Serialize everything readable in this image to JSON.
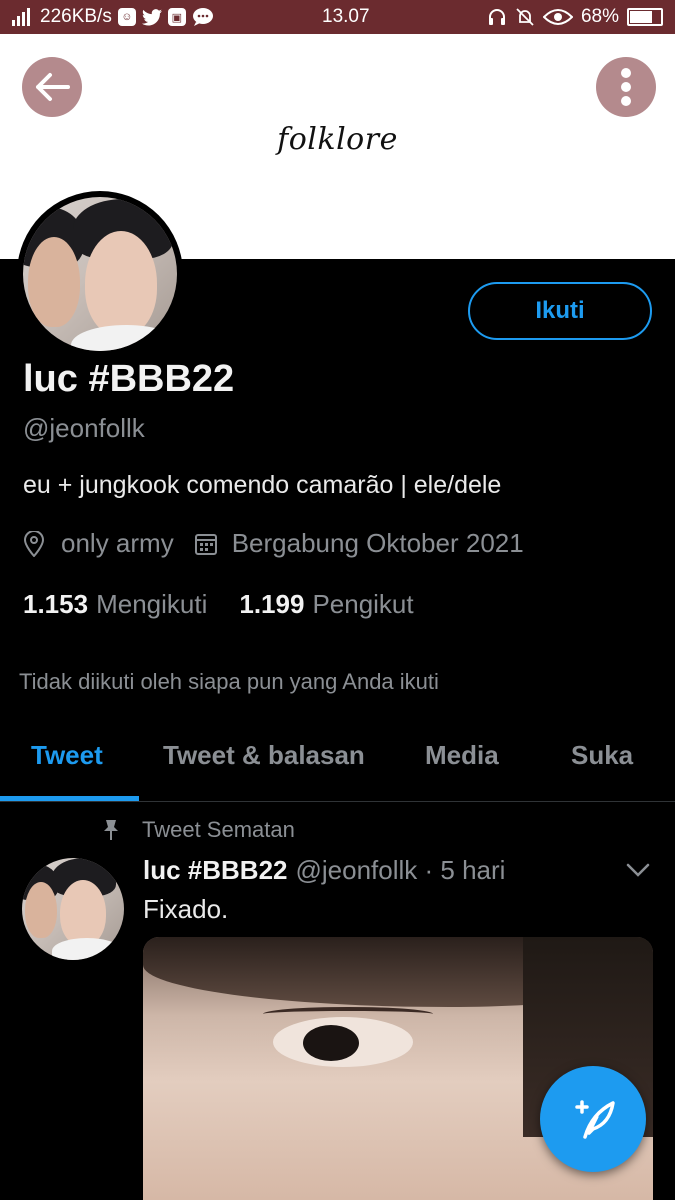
{
  "status_bar": {
    "network": "4G",
    "speed": "226KB/s",
    "time": "13.07",
    "battery": "68%",
    "battery_level": 0.68
  },
  "banner": {
    "title": "folklore",
    "back_icon": "arrow-left-icon",
    "more_icon": "more-vertical-icon"
  },
  "profile": {
    "follow_label": "Ikuti",
    "display_name": "luc #BBB22",
    "handle": "@jeonfollk",
    "bio": "eu + jungkook comendo camarão | ele/dele",
    "location": "only army",
    "joined": "Bergabung Oktober 2021",
    "following_count": "1.153",
    "following_label": "Mengikuti",
    "followers_count": "1.199",
    "followers_label": "Pengikut",
    "not_followed_note": "Tidak diikuti oleh siapa pun yang Anda ikuti"
  },
  "tabs": [
    {
      "label": "Tweet",
      "active": true
    },
    {
      "label": "Tweet & balasan",
      "active": false
    },
    {
      "label": "Media",
      "active": false
    },
    {
      "label": "Suka",
      "active": false
    }
  ],
  "pinned_tweet": {
    "pinned_label": "Tweet Sematan",
    "name": "luc #BBB22",
    "handle_time": "@jeonfollk · 5 hari",
    "text": "Fixado."
  },
  "colors": {
    "accent": "#1d9bf0",
    "status_bar": "#6b2b2f",
    "round_button": "#b48a8d",
    "muted_text": "#8b8f94"
  }
}
